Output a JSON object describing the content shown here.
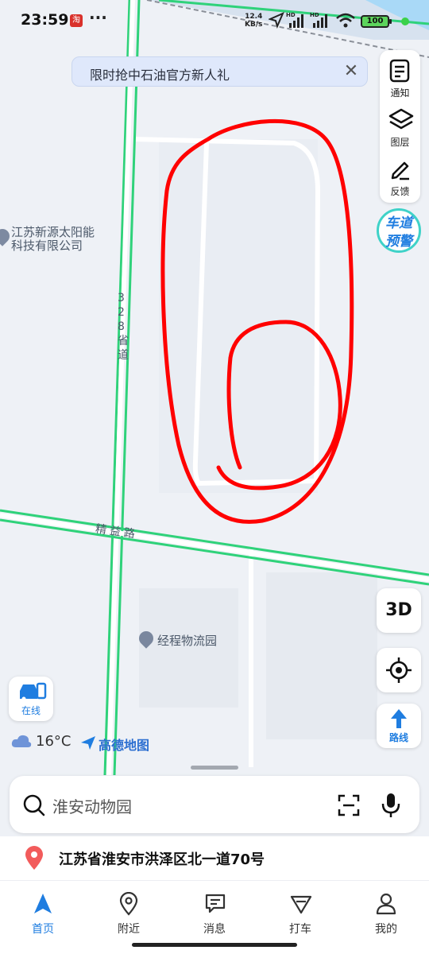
{
  "status_bar": {
    "time": "23:59",
    "net_speed_value": "12.4",
    "net_speed_unit": "KB/s",
    "battery": "100",
    "signal_label_1": "HD",
    "signal_label_2": "HD"
  },
  "promo_banner": {
    "text": "限时抢中石油官方新人礼"
  },
  "side_tools": [
    {
      "label": "通知",
      "icon": "notification-icon"
    },
    {
      "label": "图层",
      "icon": "layers-icon"
    },
    {
      "label": "反馈",
      "icon": "feedback-icon"
    }
  ],
  "lane_warning": {
    "line1": "车道",
    "line2": "预警"
  },
  "map": {
    "poi_company_line1": "江苏新源太阳能",
    "poi_company_line2": "科技有限公司",
    "road_provincial": [
      "3",
      "2",
      "8",
      "省",
      "道"
    ],
    "road_jingyi": "精益路",
    "poi_logistics": "经程物流园",
    "colors": {
      "road": "#2fd27a",
      "drawing": "#ff0000",
      "background": "#eef1f6"
    }
  },
  "controls": {
    "three_d": "3D",
    "route": "路线",
    "online": "在线"
  },
  "weather": {
    "temp": "16°C",
    "brand": "高德地图"
  },
  "search": {
    "placeholder": "淮安动物园"
  },
  "location": {
    "address": "江苏省淮安市洪泽区北一道70号"
  },
  "tabs": [
    {
      "label": "首页",
      "icon": "navigate-icon",
      "active": true
    },
    {
      "label": "附近",
      "icon": "nearby-pin-icon",
      "active": false
    },
    {
      "label": "消息",
      "icon": "message-icon",
      "active": false
    },
    {
      "label": "打车",
      "icon": "taxi-icon",
      "active": false
    },
    {
      "label": "我的",
      "icon": "profile-icon",
      "active": false
    }
  ]
}
